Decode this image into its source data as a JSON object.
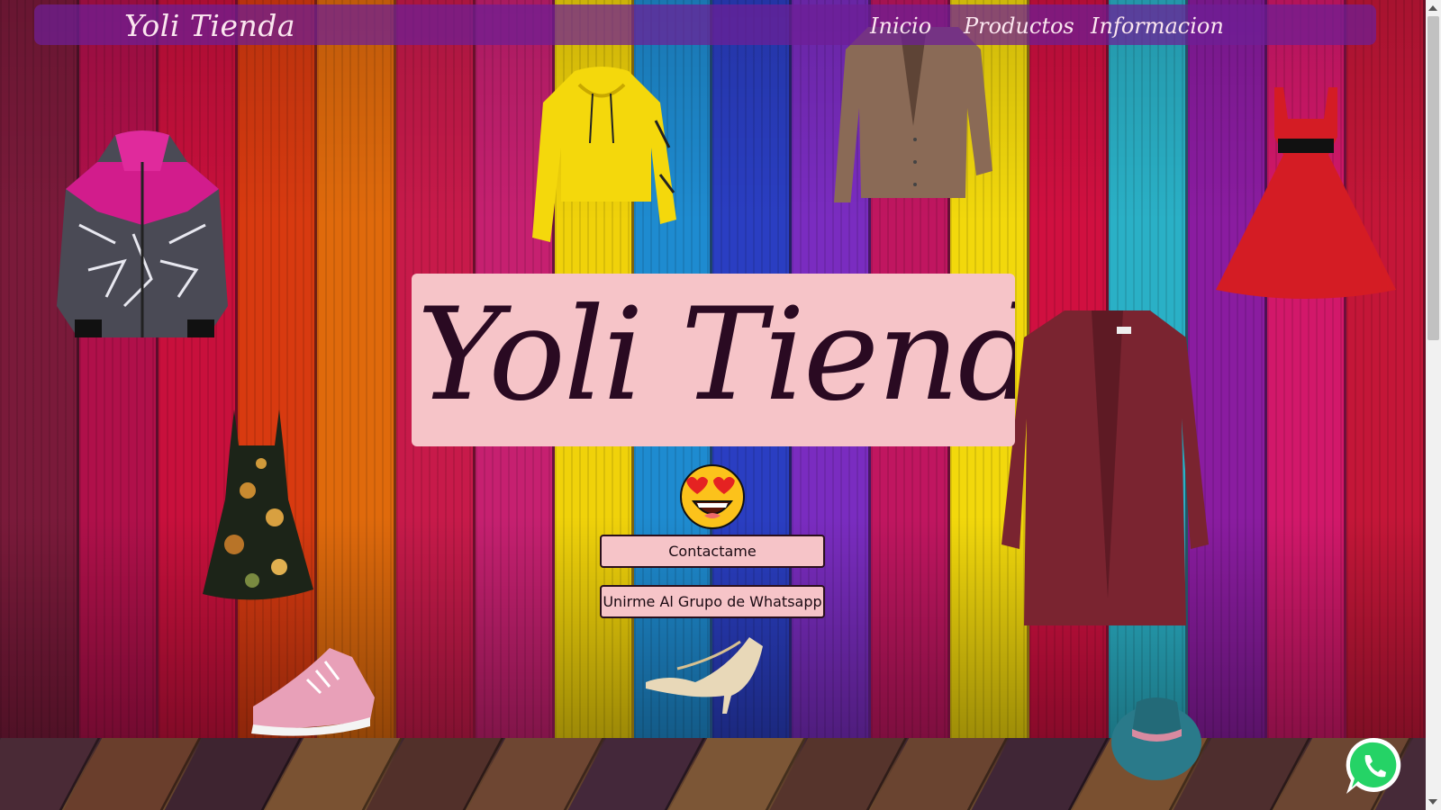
{
  "nav": {
    "brand": "Yoli Tienda",
    "links": [
      {
        "label": "Inicio"
      },
      {
        "label": "Productos"
      },
      {
        "label": "Informacion"
      }
    ]
  },
  "hero": {
    "title": "Yoli Tienda",
    "emoji_icon": "heart-eyes-emoji"
  },
  "buttons": {
    "contact": "Contactame",
    "whatsapp_group": "Unirme Al Grupo de Whatsapp"
  },
  "floating_icon": "whatsapp-icon",
  "colors": {
    "hero_bg": "#f6c4c8",
    "nav_bg": "#6e1e96",
    "title_text": "#2a0a22",
    "whatsapp_green": "#25d366"
  },
  "plank_colors": [
    "#7a1a3a",
    "#b0104a",
    "#c8103c",
    "#d83a10",
    "#e06a0c",
    "#c71a4a",
    "#c62070",
    "#f0d20a",
    "#1e8bd0",
    "#2a3ec2",
    "#7a2cc0",
    "#c01660",
    "#f2d80c",
    "#d01040",
    "#2ab0c6",
    "#8a1ca0",
    "#d2186a",
    "#c41638"
  ]
}
